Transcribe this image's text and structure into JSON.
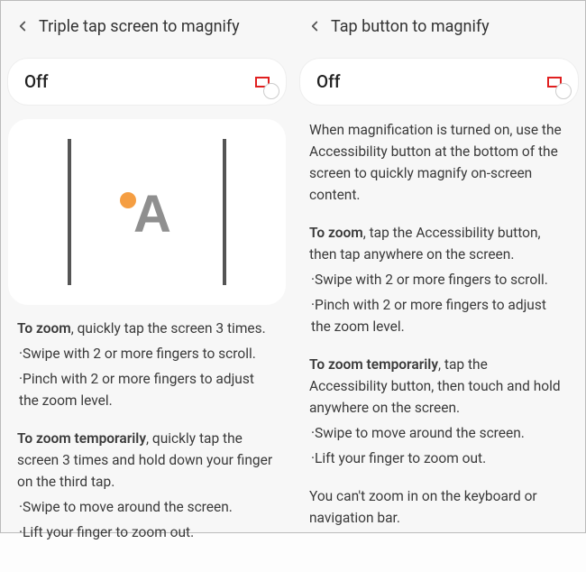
{
  "left": {
    "header_title": "Triple tap screen to magnify",
    "toggle_label": "Off",
    "zoom_intro_b": "To zoom",
    "zoom_intro_rest": ", quickly tap the screen 3 times.",
    "zoom_b1": "·Swipe with 2 or more fingers to scroll.",
    "zoom_b2": "·Pinch with 2 or more fingers to adjust the zoom level.",
    "temp_intro_b": "To zoom temporarily",
    "temp_intro_rest": ", quickly tap the screen 3 times and hold down your finger on the third tap.",
    "temp_b1": "·Swipe to move around the screen.",
    "temp_b2": "·Lift your finger to zoom out."
  },
  "right": {
    "header_title": "Tap button to magnify",
    "toggle_label": "Off",
    "intro": "When magnification is turned on, use the Accessibility button at the bottom of the screen to quickly magnify on-screen content.",
    "zoom_intro_b": "To zoom",
    "zoom_intro_rest": ", tap the Accessibility button, then tap anywhere on the screen.",
    "zoom_b1": "·Swipe with 2 or more fingers to scroll.",
    "zoom_b2": "·Pinch with 2 or more fingers to adjust the zoom level.",
    "temp_intro_b": "To zoom temporarily",
    "temp_intro_rest": ", tap the Accessibility button, then touch and hold anywhere on the screen.",
    "temp_b1": "·Swipe to move around the screen.",
    "temp_b2": "·Lift your finger to zoom out.",
    "note": "You can't zoom in on the keyboard or navigation bar."
  }
}
